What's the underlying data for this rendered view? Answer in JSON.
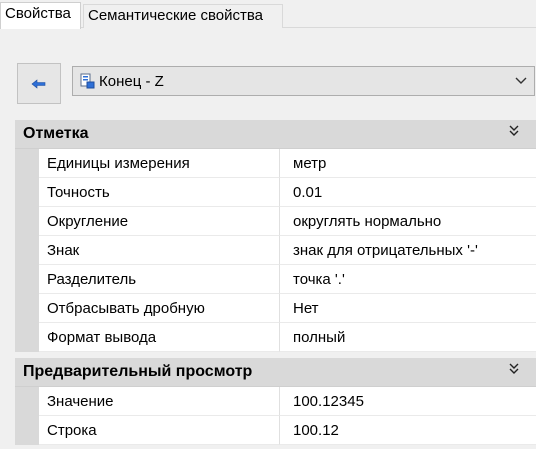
{
  "tabs": [
    {
      "label": "Свойства"
    },
    {
      "label": "Семантические свойства"
    }
  ],
  "toolbar": {
    "back_icon": "back-arrow-icon",
    "object_select": {
      "icon": "layer-object-icon",
      "value": "Конец - Z"
    }
  },
  "groups": [
    {
      "title": "Отметка",
      "rows": [
        {
          "name": "Единицы измерения",
          "value": "метр"
        },
        {
          "name": "Точность",
          "value": "0.01"
        },
        {
          "name": "Округление",
          "value": "округлять нормально"
        },
        {
          "name": "Знак",
          "value": "знак для отрицательных '-'"
        },
        {
          "name": "Разделитель",
          "value": "точка '.'"
        },
        {
          "name": "Отбрасывать дробную",
          "value": "Нет"
        },
        {
          "name": "Формат вывода",
          "value": "полный"
        }
      ]
    },
    {
      "title": "Предварительный просмотр",
      "rows": [
        {
          "name": "Значение",
          "value": "100.12345"
        },
        {
          "name": "Строка",
          "value": "100.12"
        }
      ]
    }
  ],
  "colors": {
    "accent": "#2e6fd6",
    "group_header": "#d9d9d9"
  }
}
